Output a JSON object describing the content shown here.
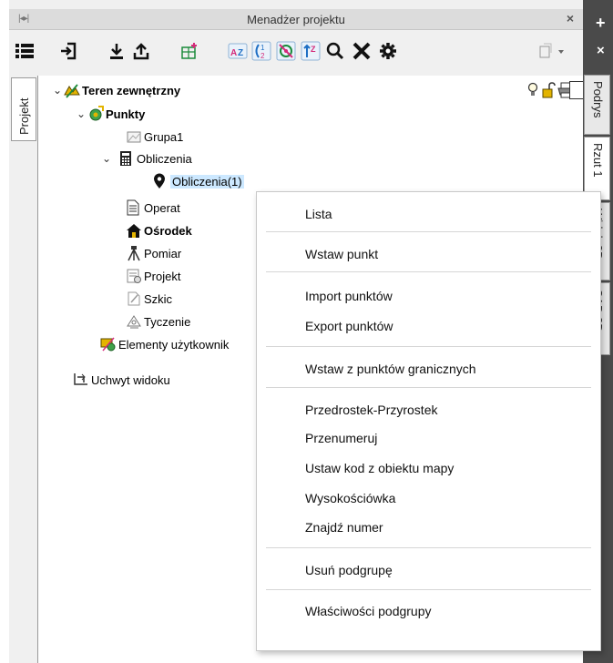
{
  "panel": {
    "title": "Menadżer projektu",
    "pin_label": "⇹",
    "close_label": "×"
  },
  "right_bar": {
    "plus_label": "+",
    "close_label": "×",
    "tabs": [
      "Podrys",
      "Rzut 1",
      "Widok 3D",
      "CAD 3D"
    ]
  },
  "left_tab": {
    "label": "Projekt"
  },
  "toolbar": {
    "icons": [
      "list-icon",
      "import-icon",
      "download-icon",
      "upload-icon",
      "add-table-icon",
      "sort-az-icon",
      "renumber-icon",
      "target-icon",
      "sort-icon",
      "search-icon",
      "delete-icon",
      "settings-icon",
      "dropdown-tool-icon"
    ]
  },
  "tree": {
    "root": "Teren zewnętrzny",
    "points": "Punkty",
    "grupa1": "Grupa1",
    "obliczenia": "Obliczenia",
    "obliczenia1": "Obliczenia(1)",
    "operat": "Operat",
    "osrodek": "Ośrodek",
    "pomiar": "Pomiar",
    "projekt": "Projekt",
    "szkic": "Szkic",
    "tyczenie": "Tyczenie",
    "elementy": "Elementy użytkownik",
    "uchwyt": "Uchwyt widoku"
  },
  "menu": {
    "lista": "Lista",
    "wstaw_punkt": "Wstaw punkt",
    "import": "Import punktów",
    "export": "Export punktów",
    "wstaw_graniczne": "Wstaw z punktów granicznych",
    "przedrostek": "Przedrostek-Przyrostek",
    "przenumeruj": "Przenumeruj",
    "ustaw_kod": "Ustaw kod z obiektu mapy",
    "wysokosciowka": "Wysokościówka",
    "znajdz": "Znajdź numer",
    "usun": "Usuń podgrupę",
    "wlasciwosci": "Właściwości podgrupy"
  }
}
